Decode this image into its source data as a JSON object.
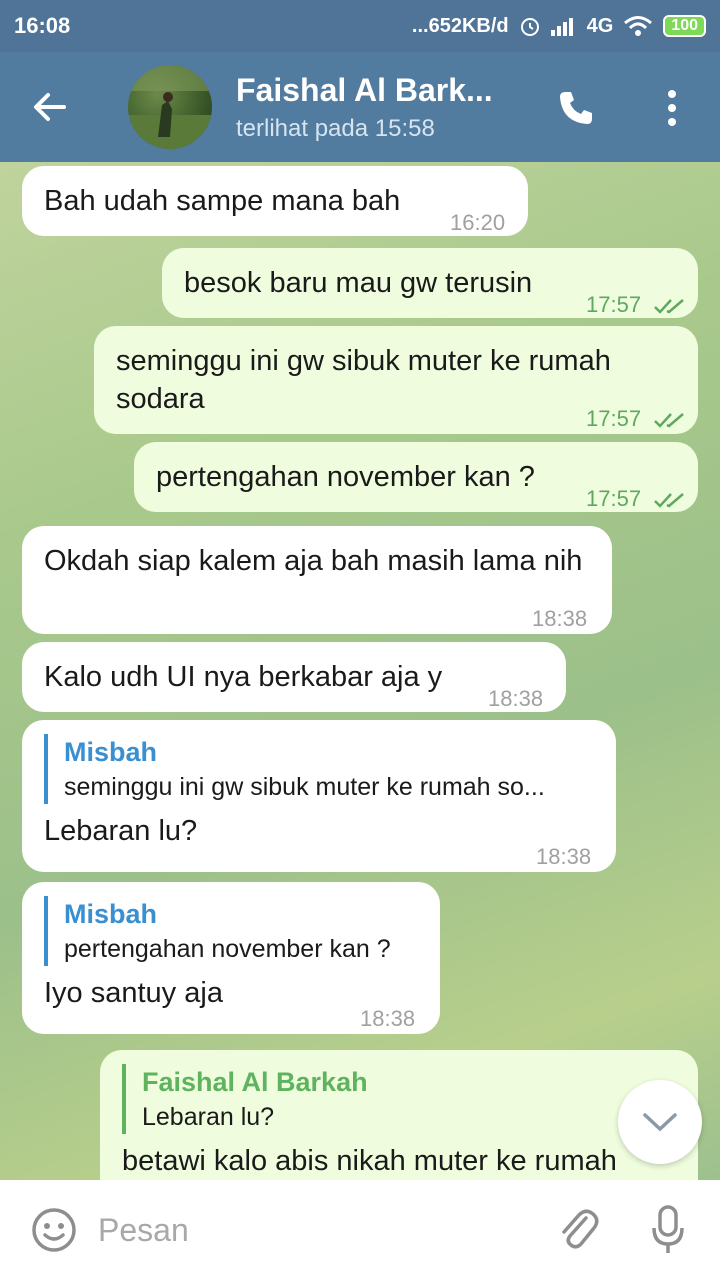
{
  "status_bar": {
    "time": "16:08",
    "network_speed": "...652KB/d",
    "network_type": "4G",
    "battery": "100"
  },
  "header": {
    "title": "Faishal Al Bark...",
    "subtitle": "terlihat pada  15:58"
  },
  "messages": [
    {
      "dir": "in",
      "text": "Bah udah sampe mana bah",
      "time": "16:20"
    },
    {
      "dir": "out",
      "text": "besok baru mau gw terusin",
      "time": "17:57"
    },
    {
      "dir": "out",
      "text": "seminggu ini gw sibuk muter ke rumah sodara",
      "time": "17:57"
    },
    {
      "dir": "out",
      "text": "pertengahan november kan ?",
      "time": "17:57"
    },
    {
      "dir": "in",
      "text": "Okdah siap kalem aja bah masih lama nih",
      "time": "18:38"
    },
    {
      "dir": "in",
      "text": "Kalo udh UI nya berkabar aja y",
      "time": "18:38"
    },
    {
      "dir": "in",
      "reply_name": "Misbah",
      "reply_text": "seminggu ini gw sibuk muter ke rumah so...",
      "text": "Lebaran lu?",
      "time": "18:38"
    },
    {
      "dir": "in",
      "reply_name": "Misbah",
      "reply_text": "pertengahan november kan ?",
      "text": "Iyo santuy aja",
      "time": "18:38"
    },
    {
      "dir": "out",
      "reply_name": "Faishal Al Barkah",
      "reply_text": "Lebaran lu?",
      "text": "betawi kalo abis nikah muter ke rumah"
    }
  ],
  "input": {
    "placeholder": "Pesan"
  },
  "icons": {
    "back": "arrow-left-icon",
    "call": "phone-icon",
    "menu": "more-vertical-icon",
    "emoji": "smiley-icon",
    "attach": "paperclip-icon",
    "mic": "microphone-icon",
    "scroll": "chevron-down-icon"
  },
  "colors": {
    "header": "#527ba0",
    "status_bar": "#4f7497",
    "outgoing_bubble": "#effdde",
    "incoming_bubble": "#ffffff",
    "reply_in": "#3a8fd1",
    "reply_out": "#5fb35f"
  }
}
